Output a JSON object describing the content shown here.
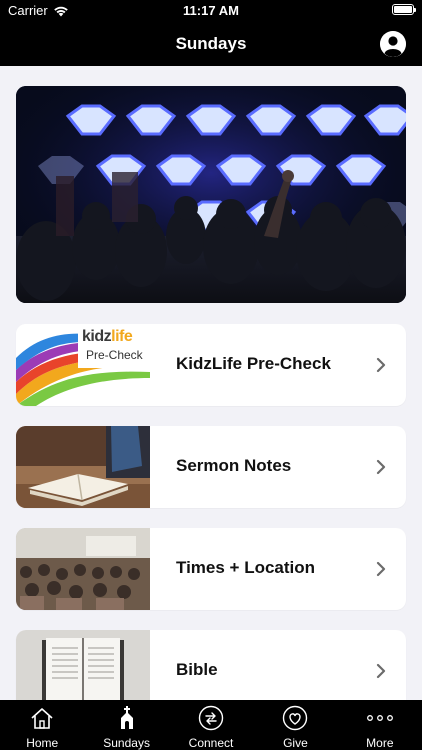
{
  "status_bar": {
    "carrier": "Carrier",
    "time": "11:17 AM"
  },
  "nav": {
    "title": "Sundays",
    "profile_icon": "person-circle-icon"
  },
  "hero": {
    "description_icon": "worship-concert-photo"
  },
  "cards": [
    {
      "label": "KidzLife Pre-Check",
      "thumb_logo": "kidzlife",
      "thumb_sub": "Pre-Check"
    },
    {
      "label": "Sermon Notes"
    },
    {
      "label": "Times + Location"
    },
    {
      "label": "Bible"
    }
  ],
  "tabs": [
    {
      "label": "Home",
      "icon": "house-icon"
    },
    {
      "label": "Sundays",
      "icon": "church-icon"
    },
    {
      "label": "Connect",
      "icon": "connect-arrows-icon"
    },
    {
      "label": "Give",
      "icon": "heart-icon"
    },
    {
      "label": "More",
      "icon": "ellipsis-icon"
    }
  ],
  "colors": {
    "bars": "#000000",
    "background": "#f2f2f7",
    "card": "#ffffff"
  }
}
